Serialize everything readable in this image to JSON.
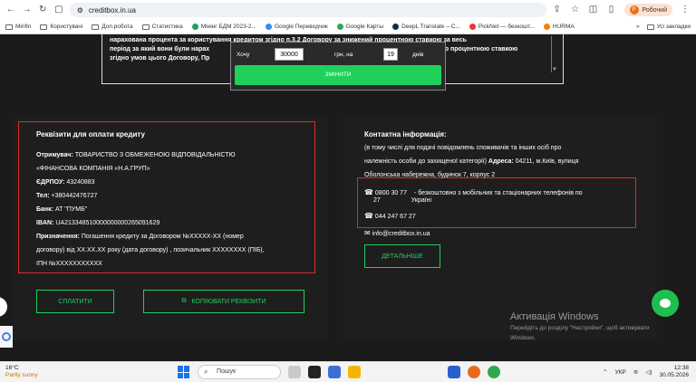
{
  "browser": {
    "url": "creditbox.in.ua",
    "profile_label": "Робочий",
    "profile_initial": "P"
  },
  "bookmarks": {
    "items": [
      "Minfin",
      "Користувачі",
      "Доп.робота",
      "Статистика",
      "Мінінг БДМ 2023-2...",
      "Google Переводчик",
      "Google Карты",
      "DeepL Translate – C...",
      "PickNet — безкошт...",
      "HURMA"
    ],
    "more": "»",
    "all": "Усі закладки"
  },
  "terms": {
    "line1": "нарахована процента за користування кредитом згідно п.3.2 Договору за знижений процентною ставкою за весь",
    "line2": "період за який вони були нарах",
    "line2b": "тною процентною ставкою",
    "line3": "згідно умов цього Договору, Пр"
  },
  "calculator": {
    "want_label": "Хочу",
    "amount": "30000",
    "currency_label": "грн, на",
    "days": "19",
    "days_label": "днів",
    "button": "ЗМІНИТИ"
  },
  "requisites": {
    "title": "Реквізити для оплати кредиту",
    "recipient_label": "Отримувач:",
    "recipient_value": " ТОВАРИСТВО З ОБМЕЖЕНОЮ ВІДПОВІДАЛЬНІСТЮ",
    "recipient_value2": "«ФІНАНСОВА КОМПАНІЯ «Н.А.ГРУП»",
    "edrpou_label": "ЄДРПОУ:",
    "edrpou_value": " 43240883",
    "tel_label": "Тел:",
    "tel_value": " +380442476727",
    "bank_label": "Банк:",
    "bank_value": " АТ \"ПУМБ\"",
    "iban_label": "IBAN:",
    "iban_value": " UA213348510000000000265091629",
    "purpose_label": "Призначення:",
    "purpose_value": " Погашення кредиту за Договором №XXXXX-XX (номер",
    "purpose_value2": "договору) від XX.XX.XX року (дата договору) , позичальник XXXXXXXX (ПІБ),",
    "purpose_value3": "ІПН №XXXXXXXXXXX",
    "pay_button": "СПЛАТИТИ",
    "copy_button": "КОПІЮВАТИ РЕКВІЗИТИ"
  },
  "contacts": {
    "title": "Контактна інформація:",
    "line1": "(в тому числі для подачі повідомлень споживачів та інших осіб про",
    "line2a": "належність особи до захищеної категорії) ",
    "address_label": "Адреса:",
    "line2b": " 04211, м.Київ, вулиця",
    "line3": "Оболонська набережна, будинок 7, корпус 2",
    "phone1": "0800 30 77",
    "phone1b": "27",
    "phone1_desc": "- безкоштовно з мобільних та стаціонарних телефонів по",
    "phone1_desc2": "Україні",
    "phone2": "044 247 67 27",
    "email": "info@creditbox.in.ua",
    "more_button": "ДЕТАЛЬНІШЕ"
  },
  "activation": {
    "title": "Активація Windows",
    "line1": "Перейдіть до розділу \"Настройки\", щоб активувати",
    "line2": "Windows."
  },
  "taskbar": {
    "temp": "16°C",
    "weather": "Partly sunny",
    "search": "Пошук",
    "lang": "УКР",
    "time": "12:38",
    "date": "30.05.2026"
  }
}
